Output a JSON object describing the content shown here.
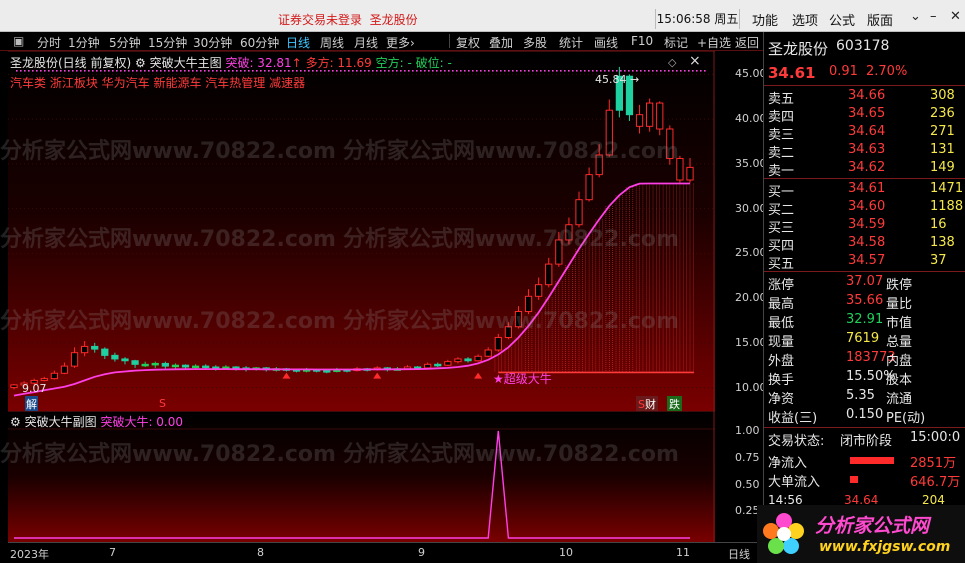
{
  "topbar": {
    "notice": "证券交易未登录",
    "stock_name": "圣龙股份",
    "time": "15:06:58 周五",
    "menu": [
      "功能",
      "选项",
      "公式",
      "版面"
    ]
  },
  "toolbar": {
    "periods": [
      "分时",
      "1分钟",
      "5分钟",
      "15分钟",
      "30分钟",
      "60分钟",
      "日线",
      "周线",
      "月线",
      "更多"
    ],
    "active_period": "日线",
    "tools": [
      "复权",
      "叠加",
      "多股",
      "统计",
      "画线",
      "F10",
      "标记",
      "+自选",
      "返回"
    ]
  },
  "chart_header": {
    "name": "圣龙股份(日线 前复权)",
    "indicator": "突破大牛主图",
    "breakout_label": "突破: 32.81",
    "long_label": "多方: 11.69",
    "short_label": "空方: -",
    "break_label": "破位: -",
    "concepts": "汽车类 浙江板块 华为汽车 新能源车 汽车热管理 减速器"
  },
  "sub_header": {
    "name": "突破大牛副图",
    "value_label": "突破大牛: 0.00"
  },
  "annotations": {
    "high": "45.84",
    "low": "9.07",
    "star": "★超级大牛",
    "tag_jie": "解",
    "tag_s": "S",
    "tag_cai": "财",
    "tag_die": "跌"
  },
  "colors": {
    "up": "#ff2a2a",
    "down": "#1fd0a0",
    "flat_up": "#1fd05a",
    "line": "#ff3fe6",
    "accent_red": "#ff3a3a",
    "accent_green": "#1fd05a",
    "accent_yellow": "#f5e84a",
    "accent_cyan": "#3fc6ff"
  },
  "chart_data": {
    "type": "candlestick",
    "ylim": [
      8.5,
      46.5
    ],
    "yticks": [
      10,
      15,
      20,
      25,
      30,
      35,
      40,
      45
    ],
    "xlabels": [
      "2023年",
      "7",
      "8",
      "9",
      "10",
      "11",
      "日线"
    ],
    "sub_yticks": [
      "1.00",
      "0.75",
      "0.50",
      "0.25"
    ],
    "candles": [
      [
        10.0,
        10.3,
        9.8,
        10.4,
        1
      ],
      [
        10.3,
        10.5,
        10.1,
        10.7,
        1
      ],
      [
        10.5,
        10.8,
        10.3,
        11.0,
        1
      ],
      [
        10.8,
        11.0,
        10.7,
        11.2,
        1
      ],
      [
        11.0,
        11.6,
        10.9,
        11.9,
        1
      ],
      [
        11.6,
        12.4,
        11.5,
        12.8,
        1
      ],
      [
        12.4,
        13.9,
        12.2,
        14.5,
        1
      ],
      [
        13.9,
        14.6,
        13.5,
        15.2,
        1
      ],
      [
        14.6,
        14.3,
        13.9,
        15.0,
        0
      ],
      [
        14.3,
        13.6,
        13.2,
        14.5,
        0
      ],
      [
        13.6,
        13.2,
        12.9,
        13.9,
        0
      ],
      [
        13.2,
        13.0,
        12.6,
        13.4,
        0
      ],
      [
        13.0,
        12.6,
        12.2,
        13.1,
        0
      ],
      [
        12.6,
        12.6,
        12.3,
        12.9,
        2
      ],
      [
        12.6,
        12.7,
        12.2,
        12.9,
        2
      ],
      [
        12.7,
        12.4,
        12.1,
        12.9,
        0
      ],
      [
        12.4,
        12.5,
        12.1,
        12.7,
        2
      ],
      [
        12.5,
        12.3,
        12.0,
        12.6,
        0
      ],
      [
        12.3,
        12.4,
        12.1,
        12.6,
        2
      ],
      [
        12.4,
        12.3,
        12.0,
        12.6,
        0
      ],
      [
        12.3,
        12.2,
        11.9,
        12.5,
        0
      ],
      [
        12.2,
        12.3,
        12.0,
        12.5,
        2
      ],
      [
        12.3,
        12.2,
        11.9,
        12.4,
        0
      ],
      [
        12.2,
        12.1,
        11.8,
        12.4,
        0
      ],
      [
        12.1,
        12.2,
        11.9,
        12.3,
        2
      ],
      [
        12.2,
        12.0,
        11.8,
        12.3,
        0
      ],
      [
        12.0,
        12.1,
        11.8,
        12.3,
        2
      ],
      [
        12.1,
        12.0,
        11.8,
        12.2,
        0
      ],
      [
        12.0,
        11.9,
        11.7,
        12.1,
        0
      ],
      [
        11.9,
        12.0,
        11.7,
        12.2,
        2
      ],
      [
        12.0,
        11.9,
        11.7,
        12.1,
        0
      ],
      [
        11.9,
        11.8,
        11.6,
        12.0,
        0
      ],
      [
        11.8,
        12.0,
        11.7,
        12.2,
        2
      ],
      [
        12.0,
        11.9,
        11.7,
        12.1,
        0
      ],
      [
        11.9,
        12.1,
        11.8,
        12.3,
        1
      ],
      [
        12.1,
        12.0,
        11.8,
        12.2,
        0
      ],
      [
        12.0,
        12.2,
        11.9,
        12.4,
        1
      ],
      [
        12.2,
        12.0,
        11.8,
        12.3,
        0
      ],
      [
        12.0,
        12.1,
        11.9,
        12.3,
        2
      ],
      [
        12.1,
        12.3,
        12.0,
        12.5,
        1
      ],
      [
        12.3,
        12.2,
        12.0,
        12.4,
        0
      ],
      [
        12.2,
        12.6,
        12.1,
        12.8,
        1
      ],
      [
        12.6,
        12.5,
        12.3,
        12.8,
        0
      ],
      [
        12.5,
        12.9,
        12.4,
        13.1,
        1
      ],
      [
        12.9,
        13.2,
        12.7,
        13.4,
        1
      ],
      [
        13.2,
        13.0,
        12.8,
        13.4,
        0
      ],
      [
        13.0,
        13.5,
        12.9,
        13.7,
        1
      ],
      [
        13.5,
        14.2,
        13.4,
        14.5,
        1
      ],
      [
        14.2,
        15.6,
        14.0,
        16.0,
        1
      ],
      [
        15.6,
        16.8,
        15.4,
        17.3,
        1
      ],
      [
        16.8,
        18.5,
        16.6,
        19.1,
        1
      ],
      [
        18.5,
        20.2,
        18.2,
        21.0,
        1
      ],
      [
        20.2,
        21.5,
        19.8,
        22.3,
        1
      ],
      [
        21.5,
        23.8,
        21.2,
        24.5,
        1
      ],
      [
        23.8,
        26.5,
        23.5,
        27.4,
        1
      ],
      [
        26.5,
        28.2,
        26.0,
        29.0,
        1
      ],
      [
        28.2,
        31.0,
        27.9,
        31.9,
        1
      ],
      [
        31.0,
        33.8,
        30.8,
        34.6,
        1
      ],
      [
        33.8,
        36.0,
        33.5,
        37.2,
        1
      ],
      [
        36.0,
        41.0,
        35.8,
        42.2,
        1
      ],
      [
        41.0,
        44.8,
        40.2,
        45.84,
        0
      ],
      [
        44.8,
        40.5,
        39.8,
        45.0,
        0
      ],
      [
        40.5,
        39.2,
        38.4,
        41.6,
        1
      ],
      [
        39.2,
        41.8,
        38.6,
        42.3,
        1
      ],
      [
        41.8,
        38.9,
        38.2,
        42.0,
        1
      ],
      [
        38.9,
        35.6,
        34.9,
        39.3,
        1
      ],
      [
        35.6,
        33.2,
        32.91,
        35.9,
        1
      ],
      [
        33.2,
        34.61,
        32.91,
        35.66,
        1
      ]
    ],
    "trend_line": [
      9.1,
      9.3,
      9.5,
      9.7,
      9.9,
      10.1,
      10.4,
      10.8,
      11.2,
      11.5,
      11.7,
      11.8,
      11.9,
      11.95,
      12.0,
      12.02,
      12.04,
      12.05,
      12.06,
      12.06,
      12.06,
      12.06,
      12.05,
      12.05,
      12.05,
      12.04,
      12.04,
      12.03,
      12.03,
      12.03,
      12.02,
      12.02,
      12.02,
      12.02,
      12.02,
      12.03,
      12.03,
      12.04,
      12.04,
      12.05,
      12.07,
      12.1,
      12.15,
      12.2,
      12.3,
      12.45,
      12.7,
      13.1,
      13.7,
      14.5,
      15.6,
      16.9,
      18.4,
      20.1,
      21.9,
      23.7,
      25.5,
      27.2,
      28.8,
      30.3,
      31.5,
      32.4,
      32.8,
      32.81,
      32.81,
      32.81,
      32.81,
      32.81
    ],
    "sub_series": [
      0,
      0,
      0,
      0,
      0,
      0,
      0,
      0,
      0,
      0,
      0,
      0,
      0,
      0,
      0,
      0,
      0,
      0,
      0,
      0,
      0,
      0,
      0,
      0,
      0,
      0,
      0,
      0,
      0,
      0,
      0,
      0,
      0,
      0,
      0,
      0,
      0,
      0,
      0,
      0,
      0,
      0,
      0,
      0,
      0,
      0,
      0,
      0,
      1,
      0,
      0,
      0,
      0,
      0,
      0,
      0,
      0,
      0,
      0,
      0,
      0,
      0,
      0,
      0,
      0,
      0,
      0,
      0
    ]
  },
  "side": {
    "name": "圣龙股份",
    "code": "603178",
    "price": "34.61",
    "change": "0.91",
    "pct": "2.70%",
    "asks": [
      [
        "卖五",
        "34.66",
        "308"
      ],
      [
        "卖四",
        "34.65",
        "236"
      ],
      [
        "卖三",
        "34.64",
        "271"
      ],
      [
        "卖二",
        "34.63",
        "131"
      ],
      [
        "卖一",
        "34.62",
        "149"
      ]
    ],
    "bids": [
      [
        "买一",
        "34.61",
        "1471"
      ],
      [
        "买二",
        "34.60",
        "1188"
      ],
      [
        "买三",
        "34.59",
        "16"
      ],
      [
        "买四",
        "34.58",
        "138"
      ],
      [
        "买五",
        "34.57",
        "37"
      ]
    ],
    "stats": [
      [
        "涨停",
        "37.07",
        "跌停"
      ],
      [
        "最高",
        "35.66",
        "量比"
      ],
      [
        "最低",
        "32.91",
        "市值"
      ],
      [
        "现量",
        "7619",
        "总量"
      ],
      [
        "外盘",
        "183773",
        "内盘"
      ],
      [
        "换手",
        "15.50%",
        "股本"
      ],
      [
        "净资",
        "5.35",
        "流通"
      ],
      [
        "收益(三)",
        "0.150",
        "PE(动)"
      ]
    ],
    "state_label": "交易状态:",
    "state_value": "闭市阶段",
    "state_time": "15:00:0",
    "net_inflow": [
      "净流入",
      "2851万"
    ],
    "big_inflow": [
      "大单流入",
      "646.7万"
    ],
    "tick": [
      "14:56",
      "34.64",
      "204"
    ]
  },
  "watermark": "分析家公式网www.70822.com",
  "logo_text": "分析家公式网",
  "logo_url": "www.fxjgsw.com"
}
